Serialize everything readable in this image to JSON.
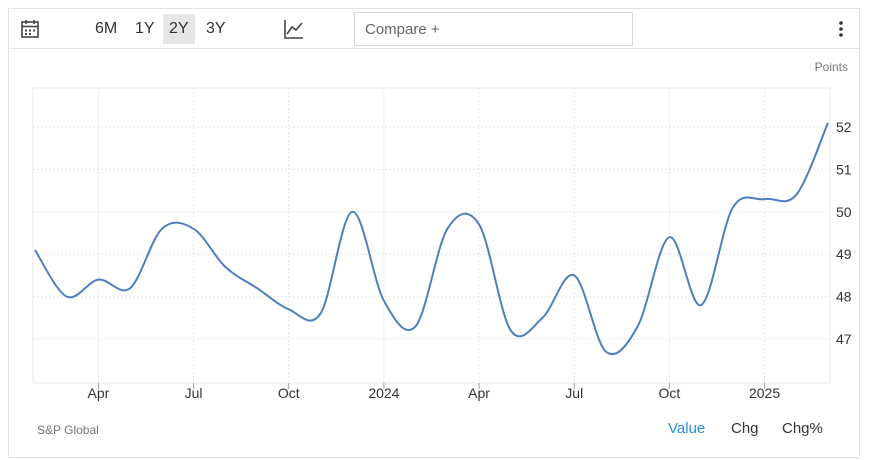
{
  "toolbar": {
    "calendar_icon": "calendar-icon",
    "ranges": [
      {
        "label": "6M",
        "active": false
      },
      {
        "label": "1Y",
        "active": false
      },
      {
        "label": "2Y",
        "active": true
      },
      {
        "label": "3Y",
        "active": false
      }
    ],
    "chart_type_icon": "line-chart-icon",
    "compare_placeholder": "Compare +",
    "more_icon": "more-vertical-icon"
  },
  "footer": {
    "source": "S&P Global",
    "modes": [
      {
        "label": "Value",
        "active": true
      },
      {
        "label": "Chg",
        "active": false
      },
      {
        "label": "Chg%",
        "active": false
      }
    ]
  },
  "colors": {
    "line": "#4f7fbf",
    "grid": "#e6e6e6",
    "active_mode": "#2a8fd6",
    "active_range_bg": "#e6e6e6"
  },
  "chart_data": {
    "type": "line",
    "unit_label": "Points",
    "x_labels": [
      "Apr",
      "Jul",
      "Oct",
      "2024",
      "Apr",
      "Jul",
      "Oct",
      "2025"
    ],
    "y_ticks": [
      47,
      48,
      49,
      50,
      51,
      52
    ],
    "ylim": [
      46,
      53
    ],
    "grid": true,
    "series": [
      {
        "x": [
          "2023-02",
          "2023-03",
          "2023-04",
          "2023-05",
          "2023-06",
          "2023-07",
          "2023-08",
          "2023-09",
          "2023-10",
          "2023-11",
          "2023-12",
          "2024-01",
          "2024-02",
          "2024-03",
          "2024-04",
          "2024-05",
          "2024-06",
          "2024-07",
          "2024-08",
          "2024-09",
          "2024-10",
          "2024-11",
          "2024-12",
          "2025-01",
          "2025-02",
          "2025-03"
        ],
        "values": [
          49.1,
          48.0,
          48.4,
          48.2,
          49.6,
          49.6,
          48.7,
          48.2,
          47.7,
          47.6,
          50.0,
          47.9,
          47.3,
          49.6,
          49.7,
          47.2,
          47.5,
          48.5,
          46.7,
          47.3,
          49.4,
          47.8,
          50.1,
          50.3,
          50.4,
          52.1
        ]
      }
    ]
  }
}
